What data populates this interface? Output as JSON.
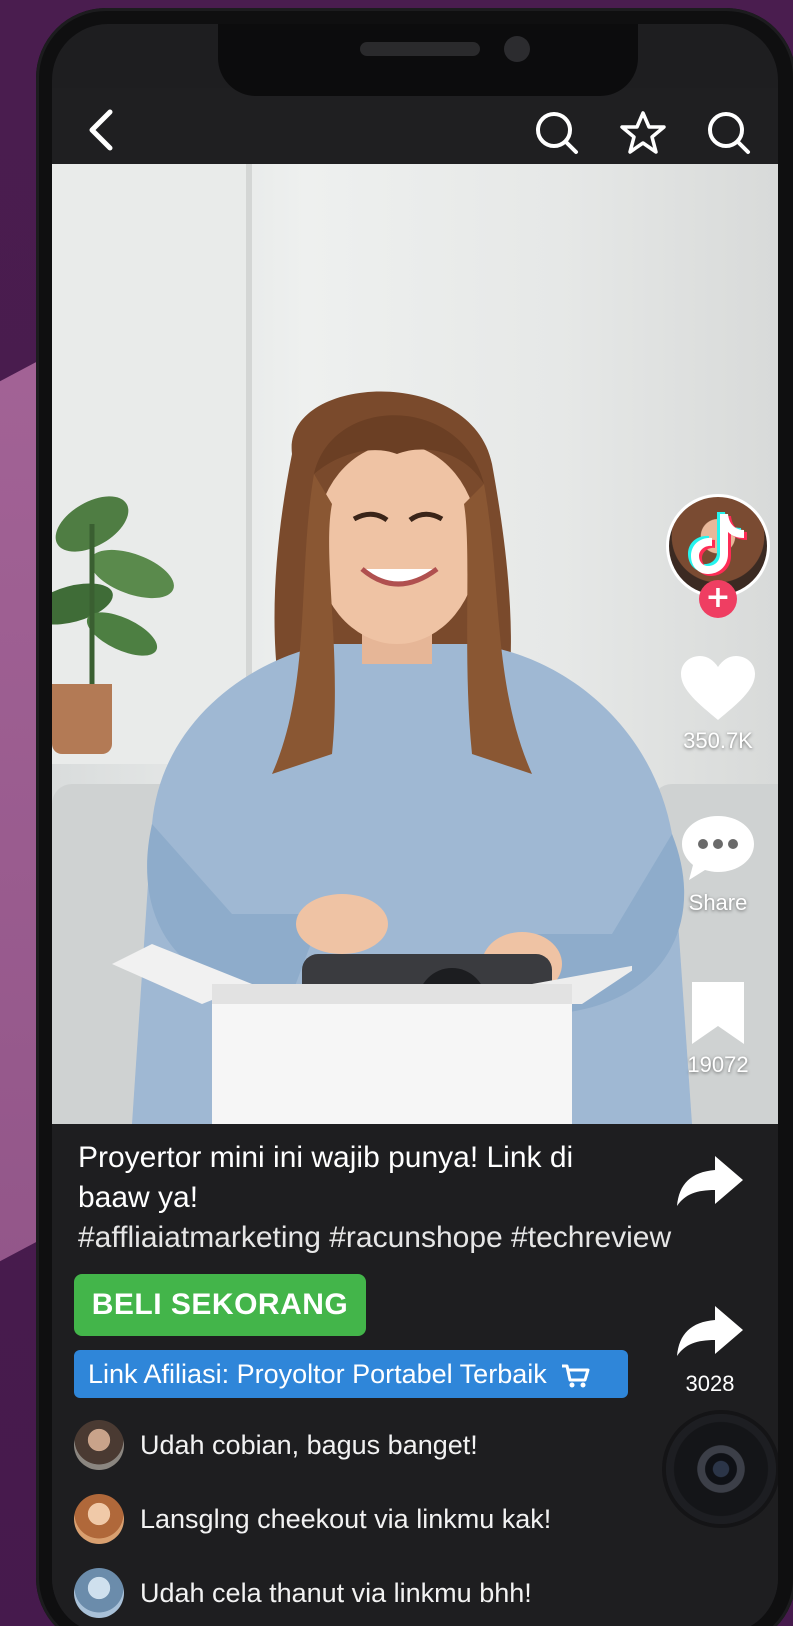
{
  "colors": {
    "background": "#4a1d4f",
    "accent_pink": "#a8679a",
    "buy_button": "#43b54a",
    "affiliate_link": "#2f86d9",
    "follow_plus": "#ef3e62"
  },
  "topbar": {
    "back_icon": "chevron-left-icon",
    "icons": [
      "search-icon",
      "star-icon",
      "search-icon"
    ]
  },
  "side_rail": {
    "likes": "350.7K",
    "comments_label": "Share",
    "bookmarks": "19072"
  },
  "post": {
    "caption": "Proyertor mini ini wajib punya! Link di baaw ya!",
    "hashtags": "#affliaiatmarketing #racunshope #techreview",
    "buy_label": "BELI SEKORANG",
    "affiliate_label": "Link Afiliasi: Proyoltor Portabel Terbaik",
    "share_count": "3028"
  },
  "comments": [
    {
      "text": "Udah cobian, bagus banget!"
    },
    {
      "text": "Lansglng cheekout via linkmu kak!"
    },
    {
      "text": "Udah cela thanut via linkmu bhh!"
    }
  ]
}
